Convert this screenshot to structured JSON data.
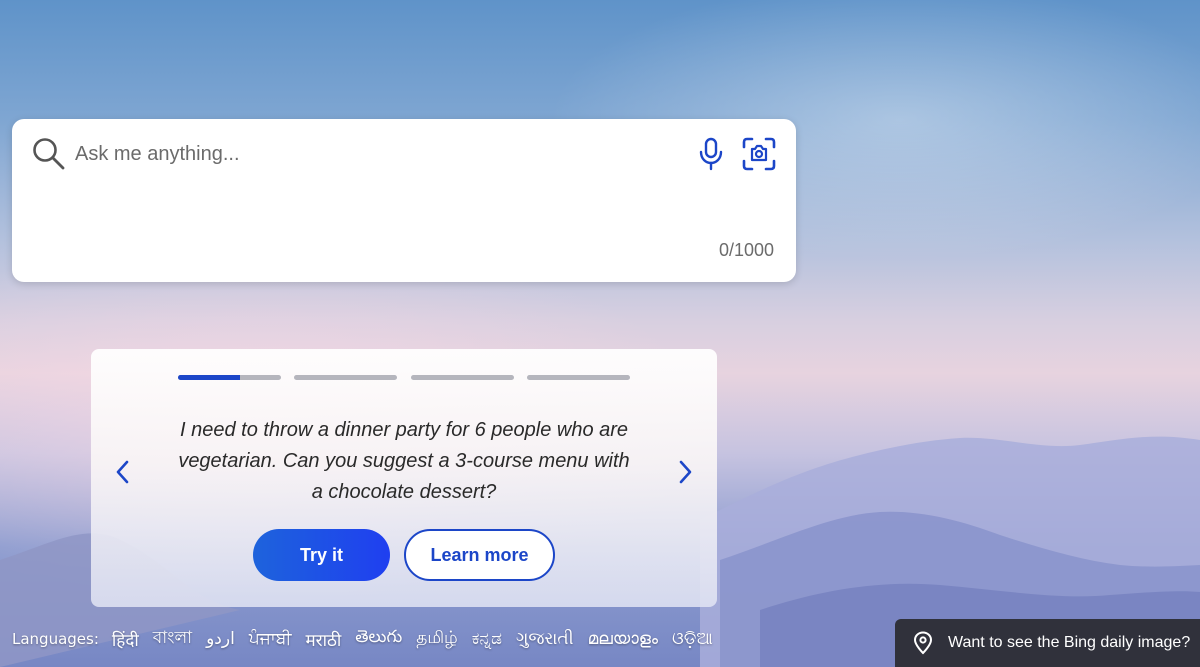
{
  "search": {
    "placeholder": "Ask me anything...",
    "value": "",
    "char_count": "0/1000",
    "icons": [
      "search-icon",
      "microphone-icon",
      "visual-search-icon"
    ]
  },
  "carousel": {
    "active_slide": 1,
    "slide_count": 4,
    "active_progress_percent": 60,
    "prompt": "I need to throw a dinner party for 6 people who are vegetarian. Can you suggest a 3-course menu with a chocolate dessert?",
    "try_label": "Try it",
    "learn_label": "Learn more",
    "prev_icon": "chevron-left-icon",
    "next_icon": "chevron-right-icon"
  },
  "languages": {
    "label": "Languages:",
    "items": [
      "हिंदी",
      "বাংলা",
      "اردو",
      "ਪੰਜਾਬੀ",
      "मराठी",
      "తెలుగు",
      "தமிழ்",
      "ಕನ್ನಡ",
      "ગુજરાતી",
      "മലയാളം",
      "ଓଡ଼ିଆ"
    ]
  },
  "daily_image": {
    "text": "Want to see the Bing daily image?",
    "icon": "location-pin-icon"
  },
  "colors": {
    "accent": "#1c46c8",
    "try_gradient_start": "#1e63dc",
    "try_gradient_end": "#1f3ff0",
    "progress_track": "#b5b5bd",
    "banner_bg": "#262628"
  }
}
